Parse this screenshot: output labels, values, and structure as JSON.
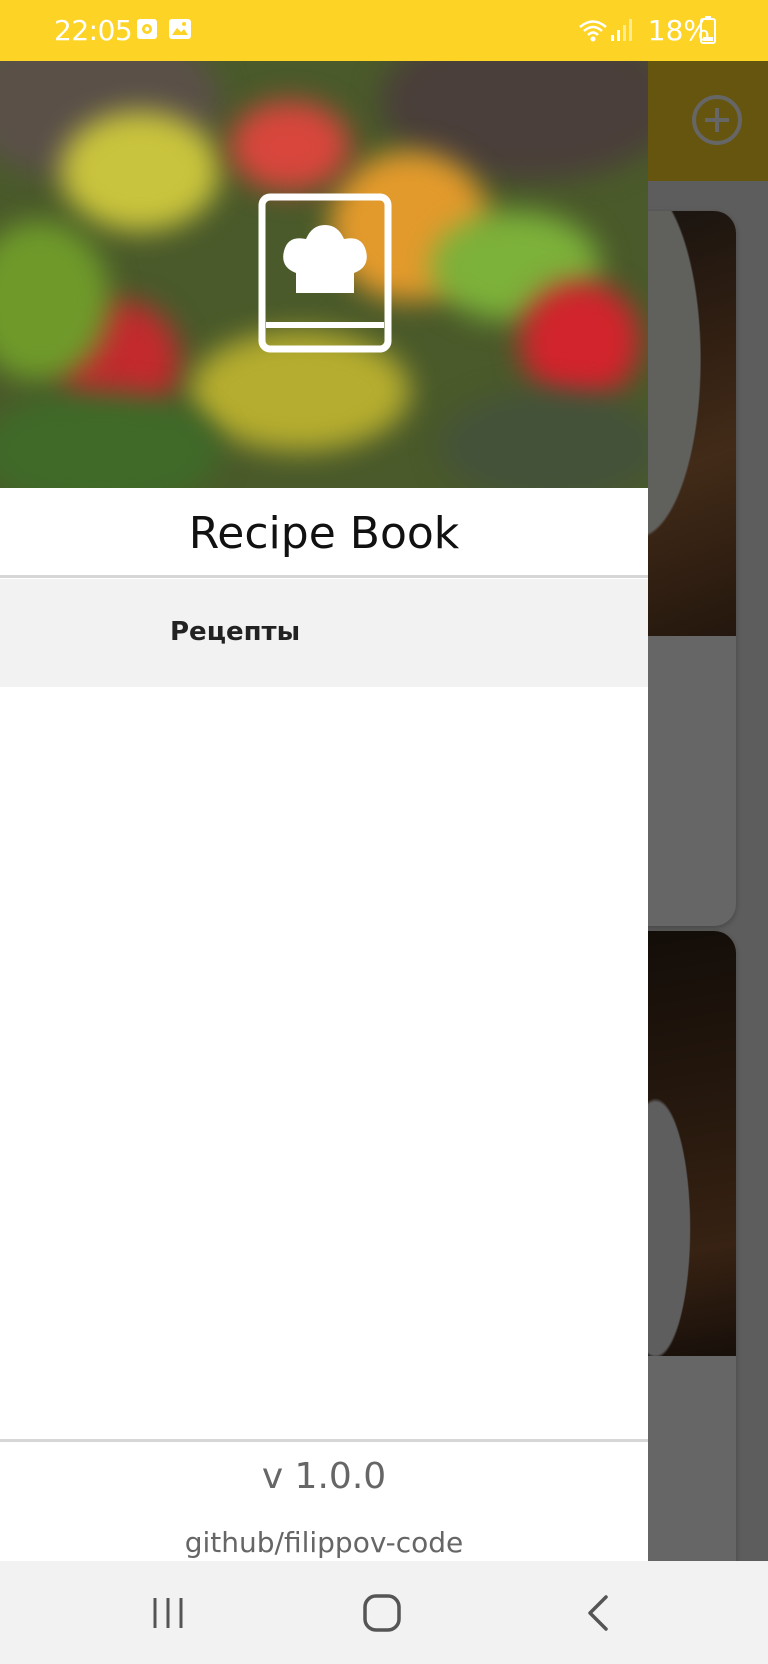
{
  "status_bar": {
    "time": "22:05",
    "battery_text": "18%",
    "icons": [
      "settings-notification-icon",
      "image-notification-icon",
      "wifi-icon",
      "signal-icon",
      "battery-icon"
    ]
  },
  "toolbar": {
    "add_icon": "plus-circle-icon"
  },
  "drawer": {
    "header_icon": "recipe-book-chef-hat-icon",
    "title": "Recipe Book",
    "menu_items": [
      {
        "label": "Рецепты"
      }
    ],
    "version": "v 1.0.0",
    "github": "github/filippov-code"
  },
  "nav_bar": {
    "buttons": [
      "recent-apps-icon",
      "home-icon",
      "back-icon"
    ]
  },
  "colors": {
    "accent": "#FDD425",
    "drawer_bg": "#FFFFFF",
    "selected_item_bg": "#F2F2F2"
  }
}
